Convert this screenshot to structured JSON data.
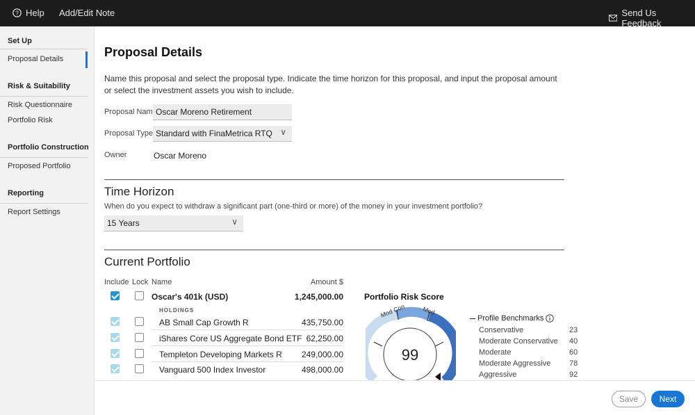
{
  "topbar": {
    "help_label": "Help",
    "note_label": "Add/Edit Note",
    "feedback_label": "Send Us Feedback"
  },
  "sidebar": {
    "sections": [
      {
        "heading": "Set Up",
        "items": [
          "Proposal Details"
        ]
      },
      {
        "heading": "Risk & Suitability",
        "items": [
          "Risk Questionnaire",
          "Portfolio Risk"
        ]
      },
      {
        "heading": "Portfolio Construction",
        "items": [
          "Proposed Portfolio"
        ]
      },
      {
        "heading": "Reporting",
        "items": [
          "Report Settings"
        ]
      }
    ]
  },
  "proposal": {
    "title": "Proposal Details",
    "description": "Name this proposal and select the proposal type. Indicate the time horizon for this proposal, and input the proposal amount or select the investment assets you wish to include.",
    "name_label": "Proposal Name",
    "name_value": "Oscar Moreno Retirement",
    "type_label": "Proposal Type",
    "type_value": "Standard with FinaMetrica RTQ",
    "owner_label": "Owner",
    "owner_value": "Oscar Moreno"
  },
  "time_horizon": {
    "title": "Time Horizon",
    "question": "When do you expect to withdraw a significant part (one-third or more) of the money in your investment portfolio?",
    "value": "15 Years"
  },
  "current_portfolio": {
    "title": "Current Portfolio",
    "columns": {
      "include": "Include",
      "lock": "Lock",
      "name": "Name",
      "amount": "Amount $"
    },
    "account": {
      "name": "Oscar's 401k (USD)",
      "amount": "1,245,000.00",
      "included": true
    },
    "holdings_label": "HOLDINGS",
    "holdings": [
      {
        "name": "AB Small Cap Growth R",
        "amount": "435,750.00"
      },
      {
        "name": "iShares Core US Aggregate Bond ETF",
        "amount": "62,250.00"
      },
      {
        "name": "Templeton Developing Markets R",
        "amount": "249,000.00"
      },
      {
        "name": "Vanguard 500 Index Investor",
        "amount": "498,000.00"
      }
    ]
  },
  "risk_score": {
    "title": "Portfolio Risk Score",
    "score": "99",
    "gauge_labels": [
      "Mod Con",
      "Mod"
    ],
    "colors": {
      "arc_light": "#c5d8ee",
      "arc_mid": "#5b8fd0",
      "arc_dark": "#2f62b0"
    }
  },
  "benchmarks": {
    "title": "Profile Benchmarks",
    "info_icon": "info-icon",
    "items": [
      {
        "label": "Conservative",
        "value": "23"
      },
      {
        "label": "Moderate Conservative",
        "value": "40"
      },
      {
        "label": "Moderate",
        "value": "60"
      },
      {
        "label": "Moderate Aggressive",
        "value": "78"
      },
      {
        "label": "Aggressive",
        "value": "92"
      }
    ]
  },
  "footer": {
    "save_label": "Save",
    "next_label": "Next"
  }
}
